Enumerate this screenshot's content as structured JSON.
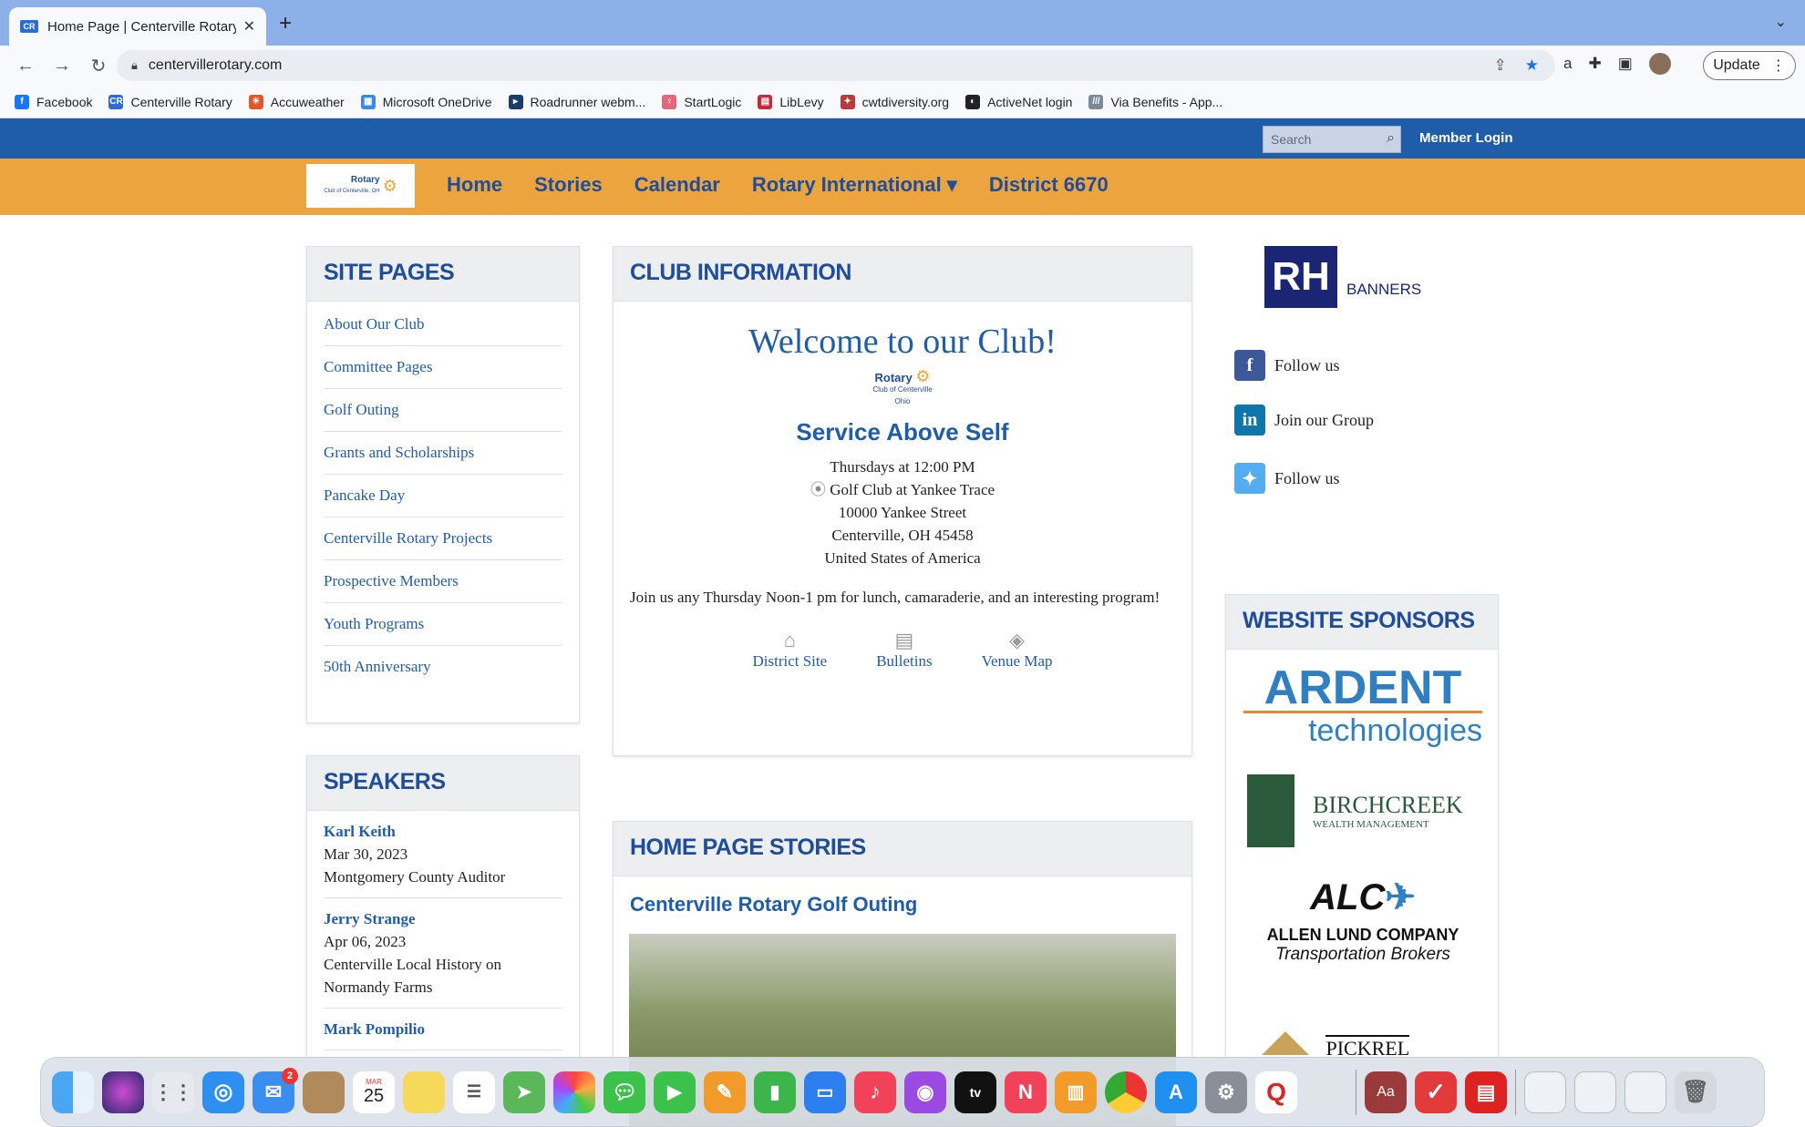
{
  "browser": {
    "tab_title": "Home Page | Centerville Rotary",
    "tab_favicon": "CR",
    "url": "centervillerotary.com",
    "update_label": "Update",
    "bookmarks": [
      {
        "label": "Facebook",
        "color": "#1877f2",
        "icon": "f"
      },
      {
        "label": "Centerville Rotary",
        "color": "#2b6dd4",
        "icon": "CR"
      },
      {
        "label": "Accuweather",
        "color": "#e0572b",
        "icon": "☀"
      },
      {
        "label": "Microsoft OneDrive",
        "color": "#3c8ae6",
        "icon": "▦"
      },
      {
        "label": "Roadrunner webm...",
        "color": "#1a3d6d",
        "icon": "▸"
      },
      {
        "label": "StartLogic",
        "color": "#e06a7a",
        "icon": "♀"
      },
      {
        "label": "LibLevy",
        "color": "#c8283c",
        "icon": "▤"
      },
      {
        "label": "cwtdiversity.org",
        "color": "#b83a3a",
        "icon": "✦"
      },
      {
        "label": "ActiveNet login",
        "color": "#222",
        "icon": "◐"
      },
      {
        "label": "Via Benefits - App...",
        "color": "#7a8a9a",
        "icon": "///"
      }
    ]
  },
  "site": {
    "search_placeholder": "Search",
    "member_login": "Member Login",
    "logo_text": "Rotary",
    "logo_sub": "Club of Centerville, OH",
    "nav": [
      "Home",
      "Stories",
      "Calendar",
      "Rotary International ▾",
      "District 6670"
    ]
  },
  "site_pages": {
    "title": "SITE PAGES",
    "items": [
      "About Our Club",
      "Committee Pages",
      "Golf Outing",
      "Grants and Scholarships",
      "Pancake Day",
      "Centerville Rotary Projects",
      "Prospective Members",
      "Youth Programs",
      "50th Anniversary"
    ]
  },
  "speakers": {
    "title": "SPEAKERS",
    "items": [
      {
        "name": "Karl Keith",
        "date": "Mar 30, 2023",
        "topic": "Montgomery County Auditor"
      },
      {
        "name": "Jerry Strange",
        "date": "Apr 06, 2023",
        "topic": "Centerville Local History on Normandy Farms"
      },
      {
        "name": "Mark Pompilio",
        "date": "",
        "topic": ""
      }
    ]
  },
  "club_info": {
    "title": "CLUB INFORMATION",
    "welcome": "Welcome to our Club!",
    "logo_text": "Rotary",
    "logo_sub1": "Club of Centerville",
    "logo_sub2": "Ohio",
    "motto": "Service Above Self",
    "meeting_time": "Thursdays at 12:00 PM",
    "venue": "Golf Club at Yankee Trace",
    "street": "10000 Yankee Street",
    "city": "Centerville, OH 45458",
    "country": "United States of America",
    "description": "Join us any Thursday Noon-1 pm for lunch, camaraderie, and an interesting program!",
    "links": [
      {
        "label": "District Site",
        "icon": "home-icon",
        "glyph": "⌂"
      },
      {
        "label": "Bulletins",
        "icon": "document-icon",
        "glyph": "▤"
      },
      {
        "label": "Venue Map",
        "icon": "map-icon",
        "glyph": "◈"
      }
    ]
  },
  "stories": {
    "title": "HOME PAGE STORIES",
    "story_title": "Centerville Rotary Golf Outing"
  },
  "right": {
    "banners_label": "BANNERS",
    "social": [
      {
        "label": "Follow us",
        "icon": "facebook-icon",
        "glyph": "f",
        "color": "#3b5998"
      },
      {
        "label": "Join our Group",
        "icon": "linkedin-icon",
        "glyph": "in",
        "color": "#0e76a8"
      },
      {
        "label": "Follow us",
        "icon": "twitter-icon",
        "glyph": "✦",
        "color": "#55acee"
      }
    ],
    "sponsors_title": "WEBSITE SPONSORS",
    "sponsors": [
      {
        "line1": "ARDENT",
        "line2": "technologies"
      },
      {
        "line1": "BIRCHCREEK",
        "line2": "WEALTH MANAGEMENT"
      },
      {
        "line1": "ALLEN LUND COMPANY",
        "line2": "Transportation Brokers"
      },
      {
        "line1": "PICKREL",
        "line2": ""
      }
    ]
  },
  "dock": {
    "calendar_month": "MAR",
    "calendar_day": "25",
    "mail_badge": "2"
  }
}
